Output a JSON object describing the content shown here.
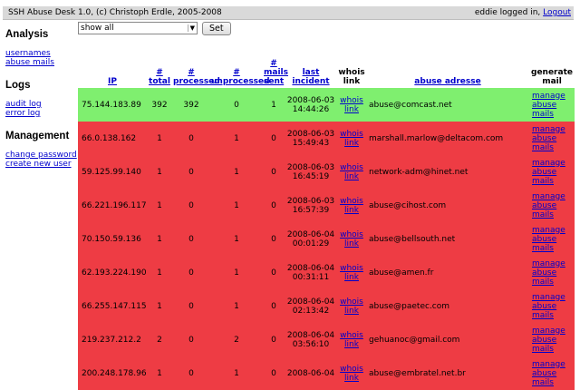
{
  "header": {
    "title": "SSH Abuse Desk 1.0, (c) Christoph Erdle, 2005-2008",
    "logged_in": "eddie logged in,",
    "logout": "Logout"
  },
  "sidebar": {
    "analysis": {
      "heading": "Analysis",
      "items": [
        "usernames",
        "abuse mails"
      ]
    },
    "logs": {
      "heading": "Logs",
      "items": [
        "audit log",
        "error log"
      ]
    },
    "management": {
      "heading": "Management",
      "items": [
        "change password",
        "create new user"
      ]
    }
  },
  "filter": {
    "selected": "show all",
    "button": "Set"
  },
  "table": {
    "headers": {
      "ip": "IP",
      "total": [
        "#",
        "total"
      ],
      "processed": [
        "#",
        "processed"
      ],
      "unprocessed": [
        "#",
        "unprocessed"
      ],
      "mails_sent": [
        "#",
        "mails",
        "sent"
      ],
      "last_incident": "last incident",
      "whois": [
        "whois",
        "link"
      ],
      "abuse_adresse": "abuse adresse",
      "generate": [
        "generate",
        "mail"
      ]
    },
    "whois_label": [
      "whois",
      "link"
    ],
    "generate_label": [
      "manage",
      "abuse",
      "mails"
    ],
    "rows": [
      {
        "status": "green",
        "ip": "75.144.183.89",
        "total": "392",
        "processed": "392",
        "unprocessed": "0",
        "sent": "1",
        "date": "2008-06-03",
        "time": "14:44:26",
        "abuse": "abuse@comcast.net"
      },
      {
        "status": "red",
        "ip": "66.0.138.162",
        "total": "1",
        "processed": "0",
        "unprocessed": "1",
        "sent": "0",
        "date": "2008-06-03",
        "time": "15:49:43",
        "abuse": "marshall.marlow@deltacom.com"
      },
      {
        "status": "red",
        "ip": "59.125.99.140",
        "total": "1",
        "processed": "0",
        "unprocessed": "1",
        "sent": "0",
        "date": "2008-06-03",
        "time": "16:45:19",
        "abuse": "network-adm@hinet.net"
      },
      {
        "status": "red",
        "ip": "66.221.196.117",
        "total": "1",
        "processed": "0",
        "unprocessed": "1",
        "sent": "0",
        "date": "2008-06-03",
        "time": "16:57:39",
        "abuse": "abuse@cihost.com"
      },
      {
        "status": "red",
        "ip": "70.150.59.136",
        "total": "1",
        "processed": "0",
        "unprocessed": "1",
        "sent": "0",
        "date": "2008-06-04",
        "time": "00:01:29",
        "abuse": "abuse@bellsouth.net"
      },
      {
        "status": "red",
        "ip": "62.193.224.190",
        "total": "1",
        "processed": "0",
        "unprocessed": "1",
        "sent": "0",
        "date": "2008-06-04",
        "time": "00:31:11",
        "abuse": "abuse@amen.fr"
      },
      {
        "status": "red",
        "ip": "66.255.147.115",
        "total": "1",
        "processed": "0",
        "unprocessed": "1",
        "sent": "0",
        "date": "2008-06-04",
        "time": "02:13:42",
        "abuse": "abuse@paetec.com"
      },
      {
        "status": "red",
        "ip": "219.237.212.2",
        "total": "2",
        "processed": "0",
        "unprocessed": "2",
        "sent": "0",
        "date": "2008-06-04",
        "time": "03:56:10",
        "abuse": "gehuanoc@gmail.com"
      },
      {
        "status": "red",
        "ip": "200.248.178.96",
        "total": "1",
        "processed": "0",
        "unprocessed": "1",
        "sent": "0",
        "date": "2008-06-04",
        "time": "",
        "abuse": "abuse@embratel.net.br"
      }
    ]
  },
  "colors": {
    "green_row": "#7fef6f",
    "red_row": "#ee3c44",
    "link": "#0000cc",
    "header_bar": "#d9d9d9"
  }
}
